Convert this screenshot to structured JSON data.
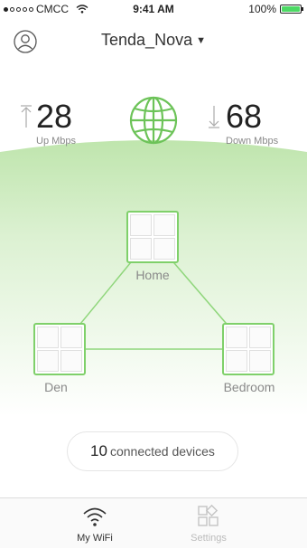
{
  "status_bar": {
    "carrier": "CMCC",
    "time": "9:41 AM",
    "battery": "100%"
  },
  "header": {
    "network_name": "Tenda_Nova"
  },
  "speed": {
    "up": {
      "value": "28",
      "label": "Up Mbps"
    },
    "down": {
      "value": "68",
      "label": "Down Mbps"
    }
  },
  "nodes": [
    {
      "label": "Home"
    },
    {
      "label": "Den"
    },
    {
      "label": "Bedroom"
    }
  ],
  "connected": {
    "count": "10",
    "label": "connected devices"
  },
  "tabs": [
    {
      "label": "My WiFi"
    },
    {
      "label": "Settings"
    }
  ],
  "colors": {
    "accent": "#7fd06a",
    "battery": "#4cd964"
  }
}
